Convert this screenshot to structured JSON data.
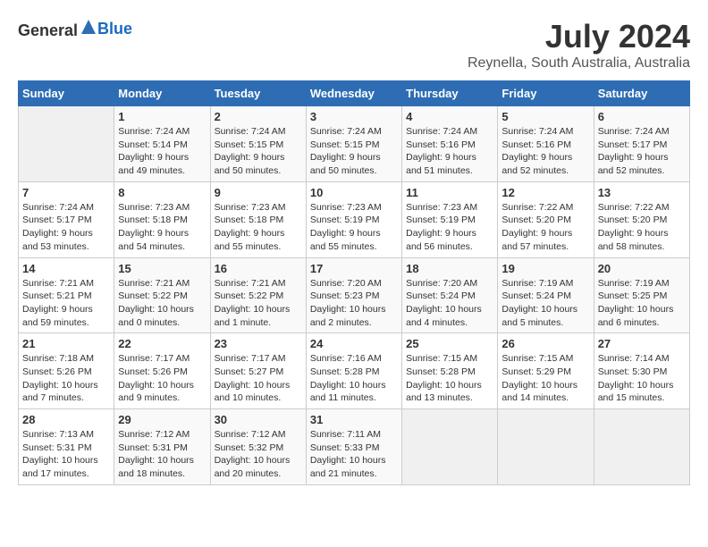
{
  "header": {
    "logo_general": "General",
    "logo_blue": "Blue",
    "month": "July 2024",
    "location": "Reynella, South Australia, Australia"
  },
  "calendar": {
    "days_of_week": [
      "Sunday",
      "Monday",
      "Tuesday",
      "Wednesday",
      "Thursday",
      "Friday",
      "Saturday"
    ],
    "weeks": [
      [
        {
          "day": "",
          "sunrise": "",
          "sunset": "",
          "daylight": ""
        },
        {
          "day": "1",
          "sunrise": "Sunrise: 7:24 AM",
          "sunset": "Sunset: 5:14 PM",
          "daylight": "Daylight: 9 hours and 49 minutes."
        },
        {
          "day": "2",
          "sunrise": "Sunrise: 7:24 AM",
          "sunset": "Sunset: 5:15 PM",
          "daylight": "Daylight: 9 hours and 50 minutes."
        },
        {
          "day": "3",
          "sunrise": "Sunrise: 7:24 AM",
          "sunset": "Sunset: 5:15 PM",
          "daylight": "Daylight: 9 hours and 50 minutes."
        },
        {
          "day": "4",
          "sunrise": "Sunrise: 7:24 AM",
          "sunset": "Sunset: 5:16 PM",
          "daylight": "Daylight: 9 hours and 51 minutes."
        },
        {
          "day": "5",
          "sunrise": "Sunrise: 7:24 AM",
          "sunset": "Sunset: 5:16 PM",
          "daylight": "Daylight: 9 hours and 52 minutes."
        },
        {
          "day": "6",
          "sunrise": "Sunrise: 7:24 AM",
          "sunset": "Sunset: 5:17 PM",
          "daylight": "Daylight: 9 hours and 52 minutes."
        }
      ],
      [
        {
          "day": "7",
          "sunrise": "Sunrise: 7:24 AM",
          "sunset": "Sunset: 5:17 PM",
          "daylight": "Daylight: 9 hours and 53 minutes."
        },
        {
          "day": "8",
          "sunrise": "Sunrise: 7:23 AM",
          "sunset": "Sunset: 5:18 PM",
          "daylight": "Daylight: 9 hours and 54 minutes."
        },
        {
          "day": "9",
          "sunrise": "Sunrise: 7:23 AM",
          "sunset": "Sunset: 5:18 PM",
          "daylight": "Daylight: 9 hours and 55 minutes."
        },
        {
          "day": "10",
          "sunrise": "Sunrise: 7:23 AM",
          "sunset": "Sunset: 5:19 PM",
          "daylight": "Daylight: 9 hours and 55 minutes."
        },
        {
          "day": "11",
          "sunrise": "Sunrise: 7:23 AM",
          "sunset": "Sunset: 5:19 PM",
          "daylight": "Daylight: 9 hours and 56 minutes."
        },
        {
          "day": "12",
          "sunrise": "Sunrise: 7:22 AM",
          "sunset": "Sunset: 5:20 PM",
          "daylight": "Daylight: 9 hours and 57 minutes."
        },
        {
          "day": "13",
          "sunrise": "Sunrise: 7:22 AM",
          "sunset": "Sunset: 5:20 PM",
          "daylight": "Daylight: 9 hours and 58 minutes."
        }
      ],
      [
        {
          "day": "14",
          "sunrise": "Sunrise: 7:21 AM",
          "sunset": "Sunset: 5:21 PM",
          "daylight": "Daylight: 9 hours and 59 minutes."
        },
        {
          "day": "15",
          "sunrise": "Sunrise: 7:21 AM",
          "sunset": "Sunset: 5:22 PM",
          "daylight": "Daylight: 10 hours and 0 minutes."
        },
        {
          "day": "16",
          "sunrise": "Sunrise: 7:21 AM",
          "sunset": "Sunset: 5:22 PM",
          "daylight": "Daylight: 10 hours and 1 minute."
        },
        {
          "day": "17",
          "sunrise": "Sunrise: 7:20 AM",
          "sunset": "Sunset: 5:23 PM",
          "daylight": "Daylight: 10 hours and 2 minutes."
        },
        {
          "day": "18",
          "sunrise": "Sunrise: 7:20 AM",
          "sunset": "Sunset: 5:24 PM",
          "daylight": "Daylight: 10 hours and 4 minutes."
        },
        {
          "day": "19",
          "sunrise": "Sunrise: 7:19 AM",
          "sunset": "Sunset: 5:24 PM",
          "daylight": "Daylight: 10 hours and 5 minutes."
        },
        {
          "day": "20",
          "sunrise": "Sunrise: 7:19 AM",
          "sunset": "Sunset: 5:25 PM",
          "daylight": "Daylight: 10 hours and 6 minutes."
        }
      ],
      [
        {
          "day": "21",
          "sunrise": "Sunrise: 7:18 AM",
          "sunset": "Sunset: 5:26 PM",
          "daylight": "Daylight: 10 hours and 7 minutes."
        },
        {
          "day": "22",
          "sunrise": "Sunrise: 7:17 AM",
          "sunset": "Sunset: 5:26 PM",
          "daylight": "Daylight: 10 hours and 9 minutes."
        },
        {
          "day": "23",
          "sunrise": "Sunrise: 7:17 AM",
          "sunset": "Sunset: 5:27 PM",
          "daylight": "Daylight: 10 hours and 10 minutes."
        },
        {
          "day": "24",
          "sunrise": "Sunrise: 7:16 AM",
          "sunset": "Sunset: 5:28 PM",
          "daylight": "Daylight: 10 hours and 11 minutes."
        },
        {
          "day": "25",
          "sunrise": "Sunrise: 7:15 AM",
          "sunset": "Sunset: 5:28 PM",
          "daylight": "Daylight: 10 hours and 13 minutes."
        },
        {
          "day": "26",
          "sunrise": "Sunrise: 7:15 AM",
          "sunset": "Sunset: 5:29 PM",
          "daylight": "Daylight: 10 hours and 14 minutes."
        },
        {
          "day": "27",
          "sunrise": "Sunrise: 7:14 AM",
          "sunset": "Sunset: 5:30 PM",
          "daylight": "Daylight: 10 hours and 15 minutes."
        }
      ],
      [
        {
          "day": "28",
          "sunrise": "Sunrise: 7:13 AM",
          "sunset": "Sunset: 5:31 PM",
          "daylight": "Daylight: 10 hours and 17 minutes."
        },
        {
          "day": "29",
          "sunrise": "Sunrise: 7:12 AM",
          "sunset": "Sunset: 5:31 PM",
          "daylight": "Daylight: 10 hours and 18 minutes."
        },
        {
          "day": "30",
          "sunrise": "Sunrise: 7:12 AM",
          "sunset": "Sunset: 5:32 PM",
          "daylight": "Daylight: 10 hours and 20 minutes."
        },
        {
          "day": "31",
          "sunrise": "Sunrise: 7:11 AM",
          "sunset": "Sunset: 5:33 PM",
          "daylight": "Daylight: 10 hours and 21 minutes."
        },
        {
          "day": "",
          "sunrise": "",
          "sunset": "",
          "daylight": ""
        },
        {
          "day": "",
          "sunrise": "",
          "sunset": "",
          "daylight": ""
        },
        {
          "day": "",
          "sunrise": "",
          "sunset": "",
          "daylight": ""
        }
      ]
    ]
  }
}
